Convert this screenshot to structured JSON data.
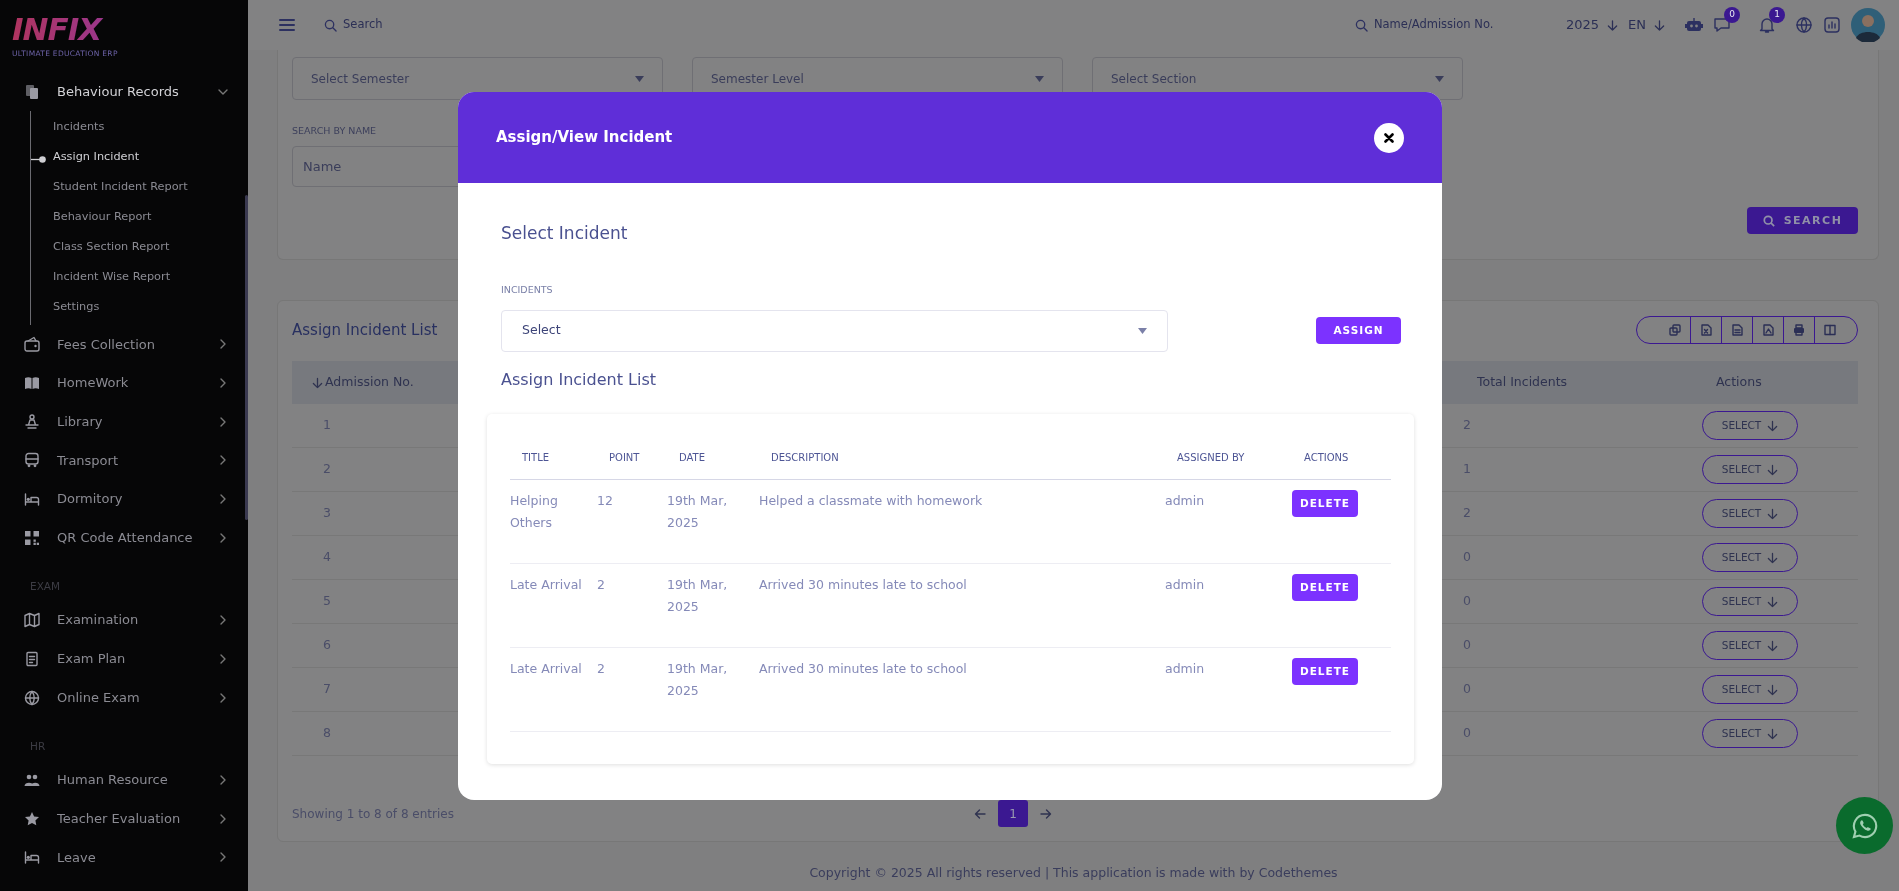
{
  "sidebar": {
    "logo": "INFIX",
    "tagline": "ULTIMATE EDUCATION ERP",
    "items": [
      {
        "kind": "menu",
        "label": "Behaviour Records",
        "expanded": true,
        "children": [
          {
            "label": "Incidents",
            "selected": false
          },
          {
            "label": "Assign Incident",
            "selected": true
          },
          {
            "label": "Student Incident Report",
            "selected": false
          },
          {
            "label": "Behaviour Report",
            "selected": false
          },
          {
            "label": "Class Section Report",
            "selected": false
          },
          {
            "label": "Incident Wise Report",
            "selected": false
          },
          {
            "label": "Settings",
            "selected": false
          }
        ]
      },
      {
        "kind": "menu",
        "label": "Fees Collection",
        "expanded": false
      },
      {
        "kind": "menu",
        "label": "HomeWork",
        "expanded": false
      },
      {
        "kind": "menu",
        "label": "Library",
        "expanded": false
      },
      {
        "kind": "menu",
        "label": "Transport",
        "expanded": false
      },
      {
        "kind": "menu",
        "label": "Dormitory",
        "expanded": false
      },
      {
        "kind": "menu",
        "label": "QR Code Attendance",
        "expanded": false
      },
      {
        "kind": "heading",
        "label": "EXAM"
      },
      {
        "kind": "menu",
        "label": "Examination",
        "expanded": false
      },
      {
        "kind": "menu",
        "label": "Exam Plan",
        "expanded": false
      },
      {
        "kind": "menu",
        "label": "Online Exam",
        "expanded": false
      },
      {
        "kind": "heading",
        "label": "HR"
      },
      {
        "kind": "menu",
        "label": "Human Resource",
        "expanded": false
      },
      {
        "kind": "menu",
        "label": "Teacher Evaluation",
        "expanded": false
      },
      {
        "kind": "menu",
        "label": "Leave",
        "expanded": false
      }
    ]
  },
  "topbar": {
    "search": {
      "placeholder": "Search"
    },
    "student_search": {
      "placeholder": "Name/Admission No."
    },
    "year": "2025",
    "language": "EN",
    "messages_count": "0",
    "notifications_count": "1"
  },
  "filters": {
    "selects": [
      {
        "text": "Select Semester"
      },
      {
        "text": "Semester Level"
      },
      {
        "text": "Select Section"
      }
    ],
    "name_label": "SEARCH BY NAME",
    "name_field": {
      "placeholder": "Name"
    },
    "search_button": "SEARCH"
  },
  "list": {
    "title": "Assign Incident List",
    "columns": [
      {
        "label": "Admission No.",
        "sorted": true
      },
      {
        "label": "Total Incidents",
        "sorted": false
      },
      {
        "label": "Actions",
        "sorted": false
      }
    ],
    "rows": [
      {
        "admission_no": "1",
        "total_incidents": "2",
        "action": "SELECT"
      },
      {
        "admission_no": "2",
        "total_incidents": "1",
        "action": "SELECT"
      },
      {
        "admission_no": "3",
        "total_incidents": "2",
        "action": "SELECT"
      },
      {
        "admission_no": "4",
        "total_incidents": "0",
        "action": "SELECT"
      },
      {
        "admission_no": "5",
        "total_incidents": "0",
        "action": "SELECT"
      },
      {
        "admission_no": "6",
        "total_incidents": "0",
        "action": "SELECT"
      },
      {
        "admission_no": "7",
        "total_incidents": "0",
        "action": "SELECT"
      },
      {
        "admission_no": "8",
        "total_incidents": "0",
        "action": "SELECT"
      }
    ],
    "summary": "Showing 1 to 8 of 8 entries",
    "pages": [
      {
        "label": "1",
        "selected": true
      }
    ]
  },
  "modal": {
    "title": "Assign/View Incident",
    "section_title": "Select Incident",
    "field_label": "INCIDENTS",
    "select": {
      "text": "Select"
    },
    "assign_button": "ASSIGN",
    "list_title": "Assign Incident List",
    "columns": [
      "TITLE",
      "POINT",
      "DATE",
      "DESCRIPTION",
      "ASSIGNED BY",
      "ACTIONS"
    ],
    "rows": [
      {
        "title": "Helping Others",
        "point": "12",
        "date": "19th Mar, 2025",
        "description": "Helped a classmate with homework",
        "assigned_by": "admin",
        "action": "DELETE"
      },
      {
        "title": "Late Arrival",
        "point": "2",
        "date": "19th Mar, 2025",
        "description": "Arrived 30 minutes late to school",
        "assigned_by": "admin",
        "action": "DELETE"
      },
      {
        "title": "Late Arrival",
        "point": "2",
        "date": "19th Mar, 2025",
        "description": "Arrived 30 minutes late to school",
        "assigned_by": "admin",
        "action": "DELETE"
      }
    ]
  },
  "footer": "Copyright © 2025 All rights reserved | This application is made with by Codethemes"
}
